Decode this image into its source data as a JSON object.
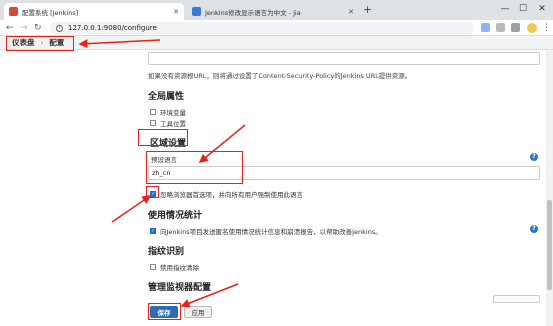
{
  "browser": {
    "tabs": [
      {
        "title": "配置系统 [Jenkins]",
        "active": true
      },
      {
        "title": "Jenkins修改显示语言为中文 - jia",
        "active": false
      }
    ],
    "new_tab": "+",
    "close_glyph": "✕",
    "window_controls": [
      "—",
      "☐",
      "✕"
    ],
    "url": "127.0.0.1:9080/configure",
    "nav_glyphs": {
      "back": "←",
      "forward": "→",
      "reload": "↻"
    }
  },
  "breadcrumb": {
    "items": [
      "仪表盘",
      "配置"
    ],
    "separator": "›"
  },
  "config": {
    "csp_help": "如果没有资源根URL，则将通过设置了Content-Security-Policy的Jenkins URL提供资源。",
    "global_props": {
      "title": "全局属性",
      "options": [
        {
          "label": "环境变量",
          "checked": false
        },
        {
          "label": "工具位置",
          "checked": false
        }
      ]
    },
    "locale": {
      "title": "区域设置",
      "default_language_label": "预设语言",
      "default_language_value": "zh_cn",
      "ignore_browser": {
        "label": "忽略浏览器首选项，并向所有用户强制使用此语言",
        "checked": true
      }
    },
    "usage_stats": {
      "title": "使用情况统计",
      "option": {
        "label": "向Jenkins项目发送匿名使用情况统计信息和崩溃报告，以帮助改善Jenkins。",
        "checked": true
      }
    },
    "fingerprint": {
      "title": "指纹识别",
      "option": {
        "label": "禁用指纹清除",
        "checked": false
      }
    },
    "monitors": {
      "title": "管理监视器配置"
    }
  },
  "buttons": {
    "save": "保存",
    "apply": "应用"
  },
  "help_glyph": "?",
  "colors": {
    "annotation": "#e8201a",
    "primary": "#2d6bb5",
    "help": "#2f77c4"
  }
}
